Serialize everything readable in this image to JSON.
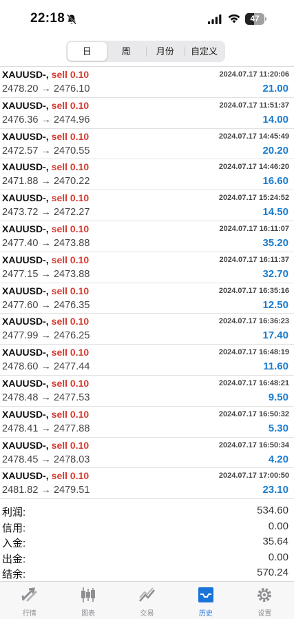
{
  "status_bar": {
    "time": "22:18",
    "battery": "47",
    "battery_level": 0.47
  },
  "tabs": [
    {
      "label": "日",
      "active": true
    },
    {
      "label": "周",
      "active": false
    },
    {
      "label": "月份",
      "active": false
    },
    {
      "label": "自定义",
      "active": false
    }
  ],
  "deals": [
    {
      "symbol": "XAUUSD-,",
      "side": "sell 0.10",
      "time": "2024.07.17 11:20:06",
      "prices": "2478.20 → 2476.10",
      "profit": "21.00"
    },
    {
      "symbol": "XAUUSD-,",
      "side": "sell 0.10",
      "time": "2024.07.17 11:51:37",
      "prices": "2476.36 → 2474.96",
      "profit": "14.00"
    },
    {
      "symbol": "XAUUSD-,",
      "side": "sell 0.10",
      "time": "2024.07.17 14:45:49",
      "prices": "2472.57 → 2470.55",
      "profit": "20.20"
    },
    {
      "symbol": "XAUUSD-,",
      "side": "sell 0.10",
      "time": "2024.07.17 14:46:20",
      "prices": "2471.88 → 2470.22",
      "profit": "16.60"
    },
    {
      "symbol": "XAUUSD-,",
      "side": "sell 0.10",
      "time": "2024.07.17 15:24:52",
      "prices": "2473.72 → 2472.27",
      "profit": "14.50"
    },
    {
      "symbol": "XAUUSD-,",
      "side": "sell 0.10",
      "time": "2024.07.17 16:11:07",
      "prices": "2477.40 → 2473.88",
      "profit": "35.20"
    },
    {
      "symbol": "XAUUSD-,",
      "side": "sell 0.10",
      "time": "2024.07.17 16:11:37",
      "prices": "2477.15 → 2473.88",
      "profit": "32.70"
    },
    {
      "symbol": "XAUUSD-,",
      "side": "sell 0.10",
      "time": "2024.07.17 16:35:16",
      "prices": "2477.60 → 2476.35",
      "profit": "12.50"
    },
    {
      "symbol": "XAUUSD-,",
      "side": "sell 0.10",
      "time": "2024.07.17 16:36:23",
      "prices": "2477.99 → 2476.25",
      "profit": "17.40"
    },
    {
      "symbol": "XAUUSD-,",
      "side": "sell 0.10",
      "time": "2024.07.17 16:48:19",
      "prices": "2478.60 → 2477.44",
      "profit": "11.60"
    },
    {
      "symbol": "XAUUSD-,",
      "side": "sell 0.10",
      "time": "2024.07.17 16:48:21",
      "prices": "2478.48 → 2477.53",
      "profit": "9.50"
    },
    {
      "symbol": "XAUUSD-,",
      "side": "sell 0.10",
      "time": "2024.07.17 16:50:32",
      "prices": "2478.41 → 2477.88",
      "profit": "5.30"
    },
    {
      "symbol": "XAUUSD-,",
      "side": "sell 0.10",
      "time": "2024.07.17 16:50:34",
      "prices": "2478.45 → 2478.03",
      "profit": "4.20"
    },
    {
      "symbol": "XAUUSD-,",
      "side": "sell 0.10",
      "time": "2024.07.17 17:00:50",
      "prices": "2481.82 → 2479.51",
      "profit": "23.10"
    }
  ],
  "summary": [
    {
      "label": "利润:",
      "value": "534.60"
    },
    {
      "label": "信用:",
      "value": "0.00"
    },
    {
      "label": "入金:",
      "value": "35.64"
    },
    {
      "label": "出金:",
      "value": "0.00"
    },
    {
      "label": "结余:",
      "value": "570.24"
    }
  ],
  "nav": [
    {
      "label": "行情",
      "icon": "quotes-arrows-icon",
      "active": false
    },
    {
      "label": "图表",
      "icon": "candlestick-chart-icon",
      "active": false
    },
    {
      "label": "交易",
      "icon": "trade-trend-icon",
      "active": false
    },
    {
      "label": "历史",
      "icon": "history-inbox-icon",
      "active": true
    },
    {
      "label": "设置",
      "icon": "settings-gear-icon",
      "active": false
    }
  ],
  "colors": {
    "sell": "#d43a2f",
    "profit": "#1a7ccf",
    "nav_active": "#1a73d9",
    "nav_inactive": "#8e8e93"
  }
}
